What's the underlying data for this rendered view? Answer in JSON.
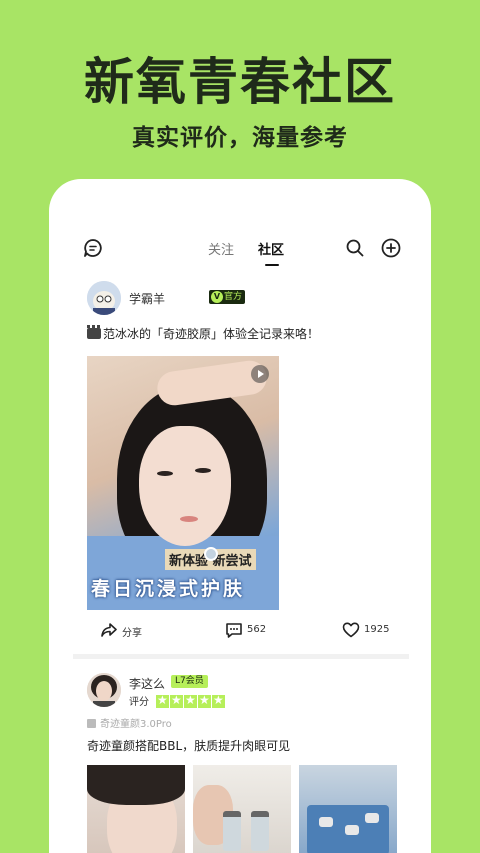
{
  "hero": {
    "title": "新氧青春社区",
    "subtitle": "真实评价，海量参考"
  },
  "topbar": {
    "tabs": [
      {
        "label": "关注",
        "active": false
      },
      {
        "label": "社区",
        "active": true
      }
    ],
    "icons": [
      "message-icon",
      "search-icon",
      "add-icon"
    ]
  },
  "post1": {
    "author": "学霸羊",
    "badge": "官方",
    "badge_mark": "V",
    "text": "范冰冰的「奇迹胶原」体验全记录来咯！",
    "video": {
      "caption_top": "新体验  新尝试",
      "caption_bottom": "春日沉浸式护肤"
    },
    "actions": {
      "share_label": "分享",
      "comment_count": "562",
      "like_count": "1925"
    }
  },
  "post2": {
    "author": "李这么",
    "level_badge": "L7会员",
    "rating_label": "评分",
    "rating_stars": 5,
    "product": "奇迹童颜3.0Pro",
    "text": "奇迹童颜搭配BBL，肤质提升肉眼可见"
  },
  "colors": {
    "brand_green": "#a8e465",
    "accent_green": "#b6ef5a",
    "dark": "#1f2a1a"
  }
}
